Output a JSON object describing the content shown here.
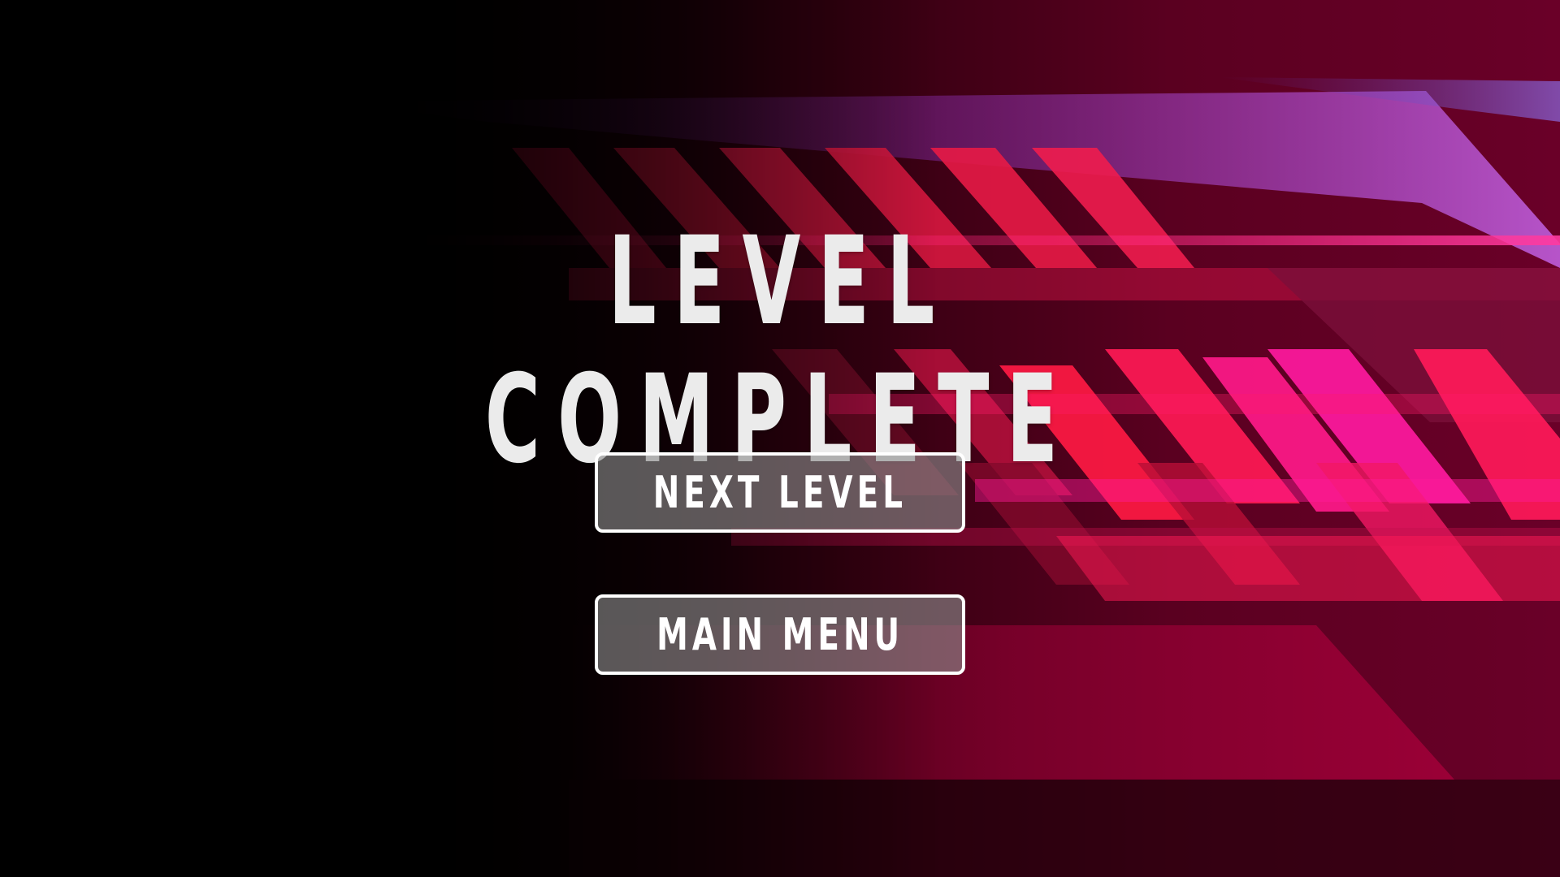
{
  "screen": {
    "title": "LEVEL COMPLETE",
    "buttons": {
      "next_level": "NEXT LEVEL",
      "main_menu": "MAIN MENU"
    }
  },
  "colors": {
    "background": "#000000",
    "accent_red": "#ff1a4a",
    "accent_magenta": "#ff1aa8",
    "accent_violet": "#b25cf0",
    "title_text": "#ebebeb",
    "button_fill": "#8c8c8c",
    "button_border": "#ffffff"
  }
}
